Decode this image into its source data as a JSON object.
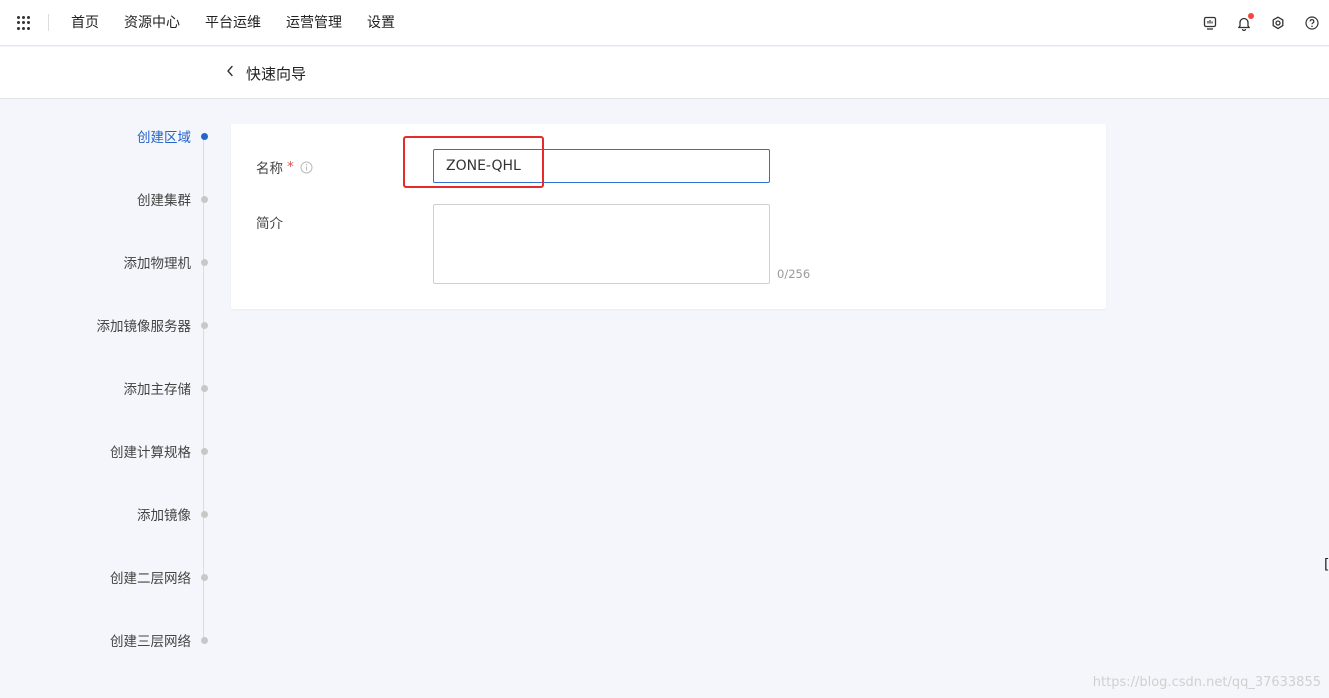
{
  "nav": {
    "items": [
      "首页",
      "资源中心",
      "平台运维",
      "运营管理",
      "设置"
    ]
  },
  "header": {
    "back_icon": "chevron-left-icon",
    "title": "快速向导"
  },
  "steps": [
    {
      "label": "创建区域",
      "active": true
    },
    {
      "label": "创建集群",
      "active": false
    },
    {
      "label": "添加物理机",
      "active": false
    },
    {
      "label": "添加镜像服务器",
      "active": false
    },
    {
      "label": "添加主存储",
      "active": false
    },
    {
      "label": "创建计算规格",
      "active": false
    },
    {
      "label": "添加镜像",
      "active": false
    },
    {
      "label": "创建二层网络",
      "active": false
    },
    {
      "label": "创建三层网络",
      "active": false
    }
  ],
  "form": {
    "name_label": "名称",
    "required_mark": "*",
    "name_value": "ZONE-QHL",
    "desc_label": "简介",
    "desc_value": "",
    "char_count": "0/256"
  },
  "colors": {
    "accent": "#2565c7",
    "highlight": "#e52b2b",
    "notification_dot": "#f2463e"
  },
  "icons": {
    "top": [
      "monitor-icon",
      "bell-icon",
      "settings-icon",
      "help-icon"
    ]
  },
  "cursor_glyph": "[",
  "watermark": "https://blog.csdn.net/qq_37633855"
}
